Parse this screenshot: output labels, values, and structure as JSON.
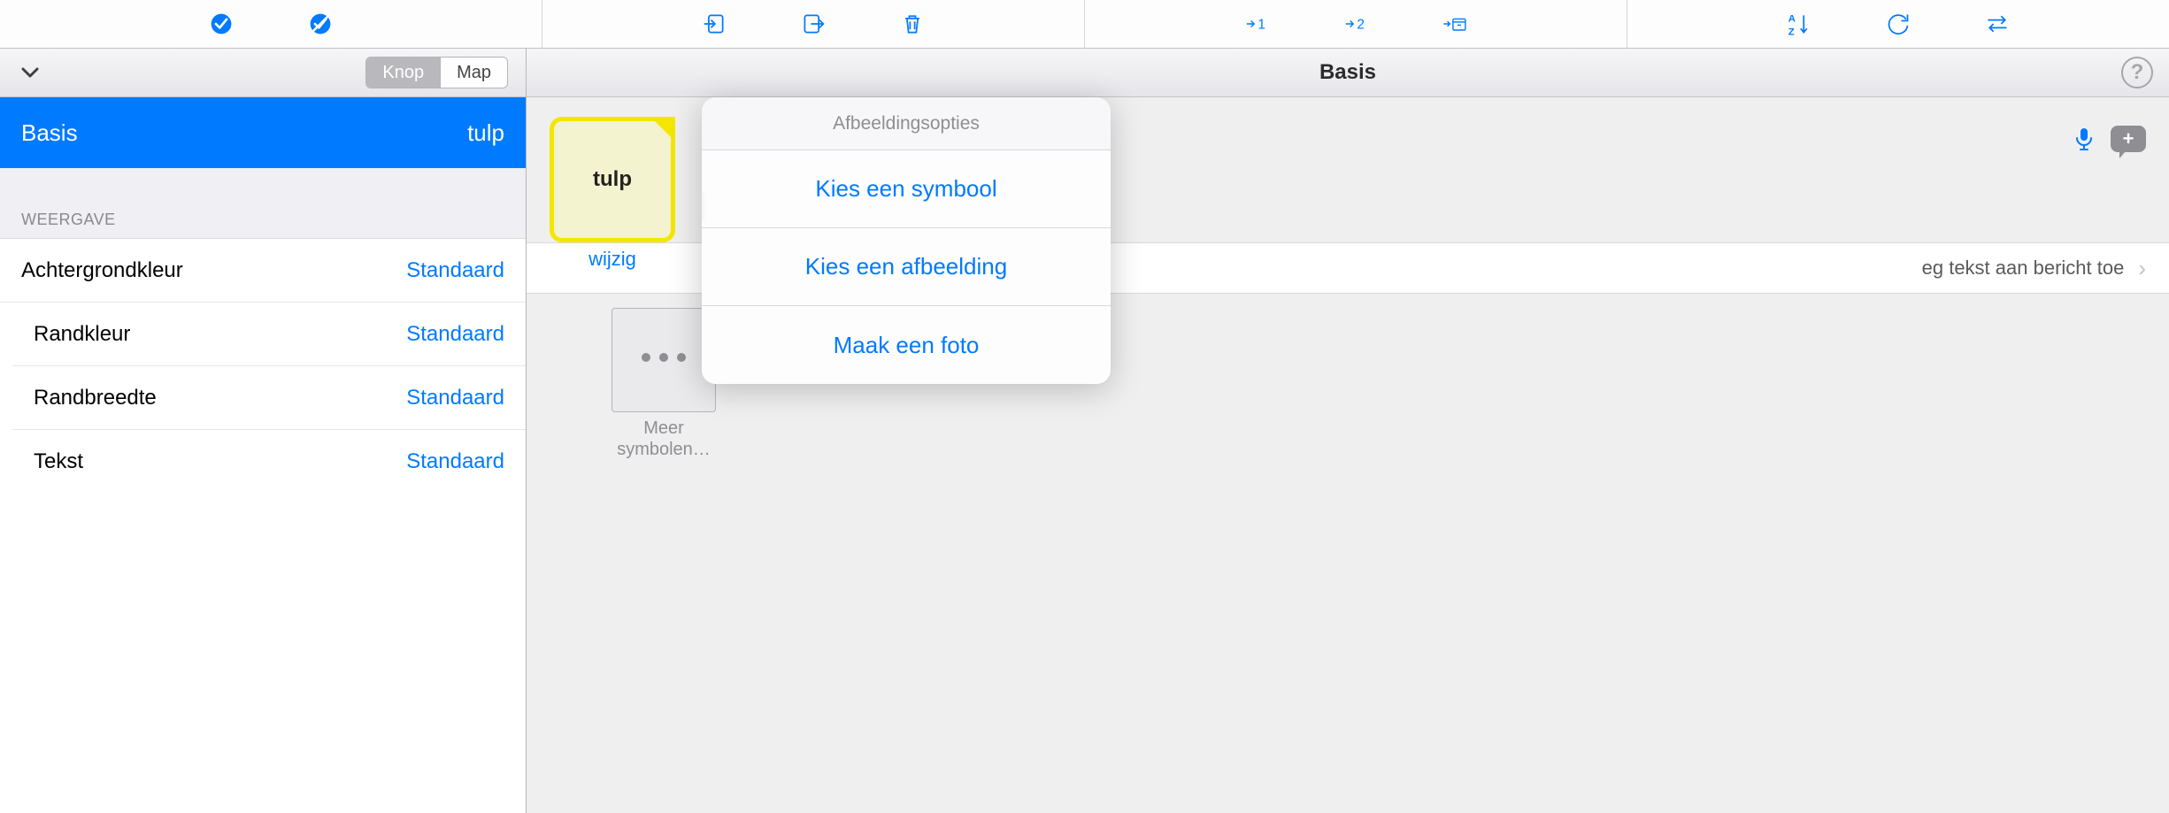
{
  "toolbar": {
    "icons": [
      "check-on",
      "check-off",
      "import",
      "export",
      "trash",
      "goto-1",
      "goto-2",
      "goto-archive",
      "sort-az",
      "refresh",
      "swap"
    ]
  },
  "left": {
    "segmented": {
      "knop": "Knop",
      "map": "Map",
      "active": "knop"
    },
    "selected": {
      "label": "Basis",
      "value": "tulp"
    },
    "section_header": "WEERGAVE",
    "props": [
      {
        "label": "Achtergrondkleur",
        "value": "Standaard"
      },
      {
        "label": "Randkleur",
        "value": "Standaard"
      },
      {
        "label": "Randbreedte",
        "value": "Standaard"
      },
      {
        "label": "Tekst",
        "value": "Standaard"
      }
    ]
  },
  "right": {
    "title": "Basis",
    "tile_label": "tulp",
    "wijzig": "wijzig",
    "msg_action": "eg tekst aan bericht toe",
    "more_line1": "Meer",
    "more_line2": "symbolen…"
  },
  "popover": {
    "header": "Afbeeldingsopties",
    "items": [
      "Kies een symbool",
      "Kies een afbeelding",
      "Maak een foto"
    ]
  }
}
